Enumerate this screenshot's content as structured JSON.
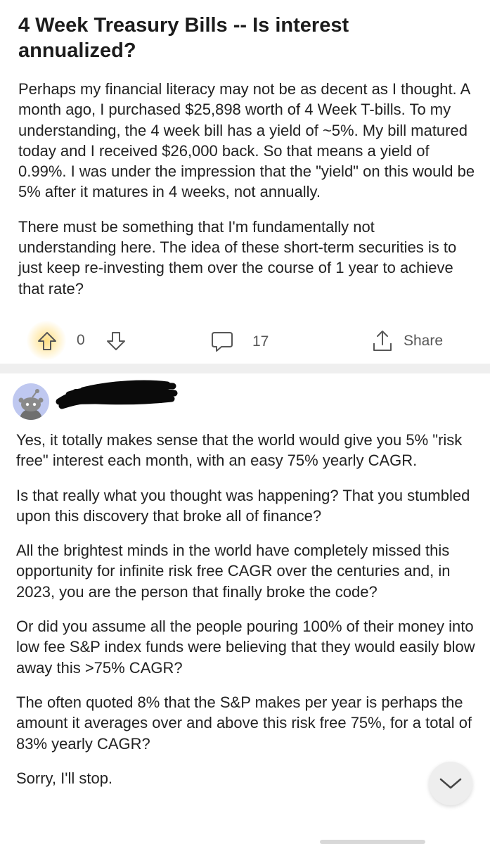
{
  "post": {
    "title": "4 Week Treasury Bills -- Is interest annualized?",
    "paragraphs": [
      "Perhaps my financial literacy may not be as decent as I thought. A month ago, I purchased $25,898 worth of 4 Week T-bills. To my understanding, the 4 week bill has a yield of ~5%. My bill matured today and I received $26,000 back. So that means a yield of 0.99%. I was under the impression that the \"yield\" on this would be 5% after it matures in 4 weeks, not annually.",
      "There must be something that I'm fundamentally not understanding here. The idea of these short-term securities is to just keep re-investing them over the course of 1 year to achieve that rate?"
    ],
    "vote_count": "0",
    "comment_count": "17",
    "share_label": "Share"
  },
  "comment": {
    "paragraphs": [
      "Yes, it totally makes sense that the world would give you 5% \"risk free\" interest each month, with an easy 75% yearly CAGR.",
      "Is that really what you thought was happening?  That you stumbled upon this discovery that broke all of finance?",
      "All the brightest minds in the world have completely missed this opportunity for infinite risk free CAGR over the centuries and, in 2023, you are the person that finally broke the code?",
      "Or did you assume all the people pouring 100% of their money into low fee S&P index funds were believing that they would easily blow away this >75% CAGR?",
      "The often quoted 8% that the S&P makes per year is perhaps the amount it averages over and above this risk free 75%, for a total of 83% yearly CAGR?",
      "Sorry, I'll stop."
    ]
  },
  "icons": {
    "upvote": "upvote-arrow-icon",
    "downvote": "downvote-arrow-icon",
    "comments": "comment-bubble-icon",
    "share": "share-icon",
    "scroll": "chevron-down-icon"
  },
  "colors": {
    "text": "#1c1c1c",
    "muted": "#575757",
    "divider": "#efefef",
    "avatar_bg": "#bfc8f0",
    "upvote_glow": "#ffd65a"
  }
}
